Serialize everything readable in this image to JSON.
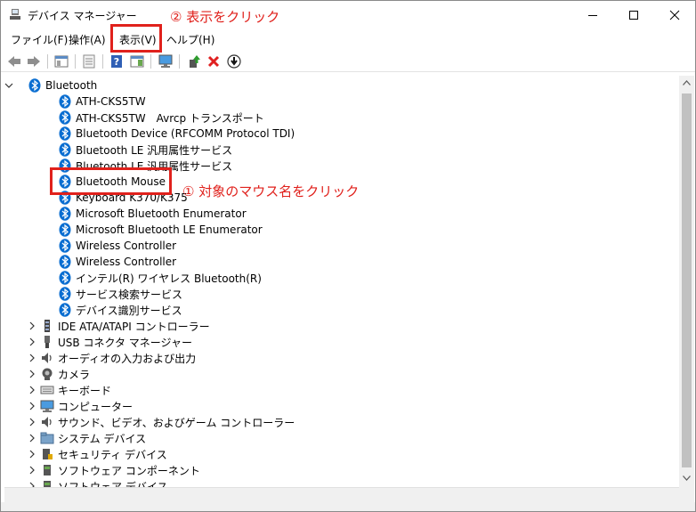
{
  "window": {
    "title": "デバイス マネージャー"
  },
  "menu": [
    "ファイル(F)",
    "操作(A)",
    "表示(V)",
    "ヘルプ(H)"
  ],
  "annotations": {
    "step2": "② 表示をクリック",
    "step1": "① 対象のマウス名をクリック",
    "color": "#e0211c"
  },
  "tree": {
    "bluetooth": {
      "label": "Bluetooth",
      "children": [
        "ATH-CKS5TW",
        "ATH-CKS5TW　Avrcp トランスポート",
        "Bluetooth Device (RFCOMM Protocol TDI)",
        "Bluetooth LE 汎用属性サービス",
        "Bluetooth LE 汎用属性サービス",
        "Bluetooth Mouse",
        "Keyboard K370/K375",
        "Microsoft Bluetooth Enumerator",
        "Microsoft Bluetooth LE Enumerator",
        "Wireless Controller",
        "Wireless Controller",
        "インテル(R) ワイヤレス Bluetooth(R)",
        "サービス検索サービス",
        "デバイス識別サービス"
      ]
    },
    "categories": [
      {
        "label": "IDE ATA/ATAPI コントローラー",
        "icon": "ide-controller-icon"
      },
      {
        "label": "USB コネクタ マネージャー",
        "icon": "usb-icon"
      },
      {
        "label": "オーディオの入力および出力",
        "icon": "speaker-icon"
      },
      {
        "label": "カメラ",
        "icon": "camera-icon"
      },
      {
        "label": "キーボード",
        "icon": "keyboard-icon"
      },
      {
        "label": "コンピューター",
        "icon": "monitor-icon"
      },
      {
        "label": "サウンド、ビデオ、およびゲーム コントローラー",
        "icon": "speaker-icon"
      },
      {
        "label": "システム デバイス",
        "icon": "folder-icon"
      },
      {
        "label": "セキュリティ デバイス",
        "icon": "security-icon"
      },
      {
        "label": "ソフトウェア コンポーネント",
        "icon": "component-icon"
      },
      {
        "label": "ソフトウェア デバイス",
        "icon": "component-icon"
      }
    ]
  },
  "colors": {
    "bluetooth": "#0a6ed1",
    "red": "#e0211c",
    "selection_border": "#99c9ef"
  }
}
